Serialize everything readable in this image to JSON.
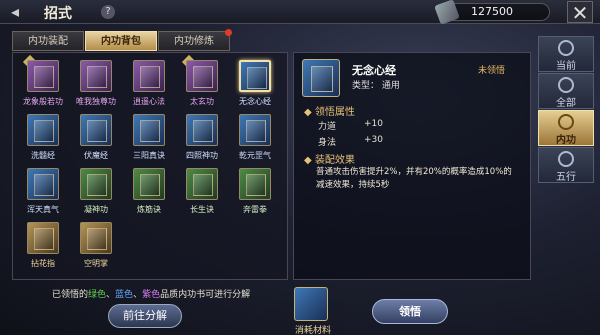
{
  "header": {
    "back_icon": "arrow-left-icon",
    "title": "招式",
    "help_icon": "question-icon",
    "currency_amount": "127500",
    "close_icon": "close-icon"
  },
  "tabs": [
    {
      "label": "内功装配"
    },
    {
      "label": "内功背包"
    },
    {
      "label": "内功修炼"
    }
  ],
  "books": [
    {
      "name": "龙象般若功",
      "rarity": "purple"
    },
    {
      "name": "唯我独尊功",
      "rarity": "purple"
    },
    {
      "name": "逍遥心法",
      "rarity": "purple"
    },
    {
      "name": "太玄功",
      "rarity": "purple"
    },
    {
      "name": "无念心经",
      "rarity": "blue"
    },
    {
      "name": "洗髓经",
      "rarity": "blue"
    },
    {
      "name": "伏魔经",
      "rarity": "blue"
    },
    {
      "name": "三阳真诀",
      "rarity": "blue"
    },
    {
      "name": "四照神功",
      "rarity": "blue"
    },
    {
      "name": "乾元罡气",
      "rarity": "blue"
    },
    {
      "name": "浑天真气",
      "rarity": "blue"
    },
    {
      "name": "凝神功",
      "rarity": "green"
    },
    {
      "name": "炼筋诀",
      "rarity": "green"
    },
    {
      "name": "长生诀",
      "rarity": "green"
    },
    {
      "name": "奔雷拳",
      "rarity": "green"
    },
    {
      "name": "拈花指",
      "rarity": "gold"
    },
    {
      "name": "空明掌",
      "rarity": "gold"
    }
  ],
  "hint": {
    "prefix": "已领悟的",
    "green": "绿色",
    "sep1": "、",
    "blue": "蓝色",
    "sep2": "、",
    "purple": "紫色",
    "suffix": "品质内功书可进行分解"
  },
  "decompose_label": "前往分解",
  "detail": {
    "name": "无念心经",
    "type": "类型：  通用",
    "status": "未领悟",
    "attr_title": "◆ 领悟属性",
    "stats": [
      {
        "label": "力道",
        "value": "+10"
      },
      {
        "label": "身法",
        "value": "+30"
      }
    ],
    "effect_title": "◆ 装配效果",
    "effect": "普通攻击伤害提升2%，并有20%的概率造成10%的减速效果，持续5秒"
  },
  "material_label": "消耗材料",
  "comprehend_label": "领悟",
  "sidebar": [
    {
      "label": "当前",
      "icon": "current-icon"
    },
    {
      "label": "全部",
      "icon": "all-icon"
    },
    {
      "label": "内功",
      "icon": "inner-power-icon"
    },
    {
      "label": "五行",
      "icon": "five-elements-icon"
    }
  ]
}
